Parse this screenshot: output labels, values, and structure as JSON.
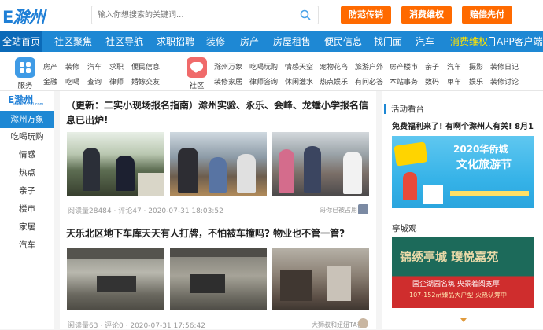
{
  "header": {
    "logo_a": "E",
    "logo_b": "滁州",
    "search_placeholder": "输入你想搜索的关键词...",
    "buttons": [
      "防范传销",
      "消费维权",
      "赔偿先付"
    ]
  },
  "nav": {
    "items": [
      "全站首页",
      "社区聚焦",
      "社区导航",
      "求职招聘",
      "装修",
      "房产",
      "房屋租售",
      "便民信息",
      "找门面",
      "汽车",
      "消费维权",
      "APP客户端"
    ]
  },
  "categories": {
    "service": {
      "label": "服务",
      "row1": [
        "房产",
        "装修",
        "汽车",
        "求职",
        "便民信息"
      ],
      "row2": [
        "金融",
        "吃喝",
        "查询",
        "律师",
        "婚嫁交友"
      ]
    },
    "community": {
      "label": "社区",
      "row1": [
        "滁州万象",
        "吃喝玩购",
        "情感天空",
        "宠物花鸟",
        "旅游户外",
        "房产楼市",
        "亲子",
        "汽车",
        "摄影",
        "装修日记"
      ],
      "row2": [
        "装修家居",
        "律师咨询",
        "休闲灌水",
        "热点娱乐",
        "有问必答",
        "本站事务",
        "数码",
        "单车",
        "娱乐",
        "装修讨论"
      ]
    }
  },
  "sidebar": {
    "logo": "E滁州",
    "logo_sub": "www.0550.com",
    "items": [
      "滁州万象",
      "吃喝玩购",
      "情感",
      "热点",
      "亲子",
      "楼市",
      "家居",
      "汽车"
    ]
  },
  "posts": [
    {
      "title": "（更新：二实小现场报名指南）滁州实验、永乐、会峰、龙蟠小学报名信息已出炉!",
      "meta": "阅读量28484 · 评论47 · 2020-07-31 18:03:52",
      "author": "哥你已被占用"
    },
    {
      "title": "天乐北区地下车库天天有人打牌，不怕被车撞吗? 物业也不管一管?",
      "meta": "阅读量63 · 评论0 · 2020-07-31 17:56:42",
      "author": "大狮叔和妞妞TA爸"
    }
  ],
  "right": {
    "section1": "活动看台",
    "headline": "免费福利来了! 有啊个滁州人有关! 8月1",
    "ad1_title": "2020华侨城",
    "ad1_sub": "文化旅游节",
    "section2": "亭城观",
    "ad2_calligraphy": "锦绣亭城 璞悦嘉苑",
    "ad2_line1": "国企湖园名筑  央景着阅宽厚",
    "ad2_line2": "107-152㎡臻品大户型 火热认筹中"
  },
  "colors": {
    "brand_blue": "#1e88d4",
    "nav_active": "#0b6ab8",
    "orange": "#ff6a00",
    "highlight": "#ffe400"
  }
}
